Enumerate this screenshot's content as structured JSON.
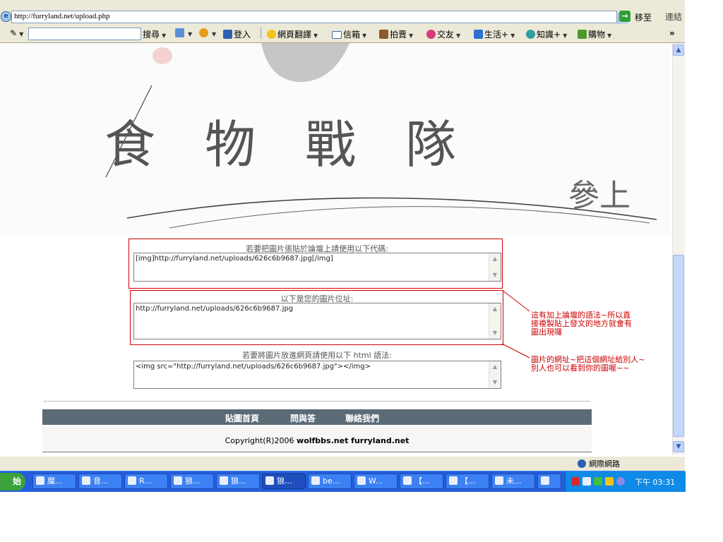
{
  "browser": {
    "address": "http://furryland.net/upload.php",
    "go_label": "移至",
    "links_label": "連結",
    "search_value": "",
    "toolbar": [
      {
        "label": "搜尋",
        "icon": "search-icon"
      },
      {
        "label": "",
        "icon": "layout-icon"
      },
      {
        "label": "",
        "icon": "crosshair-icon"
      },
      {
        "label": "登入",
        "icon": "login-icon"
      },
      {
        "label": "網頁翻譯",
        "icon": "translate-icon"
      },
      {
        "label": "信箱",
        "icon": "mail-icon"
      },
      {
        "label": "拍賣",
        "icon": "auction-icon"
      },
      {
        "label": "交友",
        "icon": "dating-icon"
      },
      {
        "label": "生活+",
        "icon": "life-icon"
      },
      {
        "label": "知識+",
        "icon": "knowledge-icon"
      },
      {
        "label": "購物",
        "icon": "shopping-icon"
      }
    ],
    "more_label": "»",
    "status_zone": "網際網路"
  },
  "page": {
    "banner_title": "食物戰隊",
    "banner_sig": "參上",
    "sections": [
      {
        "label": "若要把圖片張貼於論壇上請使用以下代碼:",
        "code": "[img]http://furryland.net/uploads/626c6b9687.jpg[/img]"
      },
      {
        "label": "以下是您的圖片位址:",
        "code": "http://furryland.net/uploads/626c6b9687.jpg"
      },
      {
        "label": "若要將圖片放進網頁請使用以下 html 語法:",
        "code": "<img src=\"http://furryland.net/uploads/626c6b9687.jpg\"></img>"
      }
    ],
    "annotations": [
      {
        "lines": [
          "這有加上論壇的語法~所以直",
          "接複製貼上發文的地方就會有",
          "圖出現囉"
        ]
      },
      {
        "lines": [
          "圖片的網址~把這個網址給別人~",
          "別人也可以看到你的圖喔~~"
        ]
      }
    ],
    "nav": [
      "貼圖首頁",
      "問與答",
      "聯絡我們"
    ],
    "copyright_prefix": "Copyright(R)2006 ",
    "copyright_sites": "wolfbbs.net furryland.net"
  },
  "taskbar": {
    "start_label": "始",
    "tasks": [
      "魔...",
      "音...",
      "R...",
      "狼...",
      "狼...",
      "狼...",
      "be...",
      "W...",
      "【...",
      "【...",
      "未...",
      ""
    ],
    "clock": "下午 03:31"
  }
}
